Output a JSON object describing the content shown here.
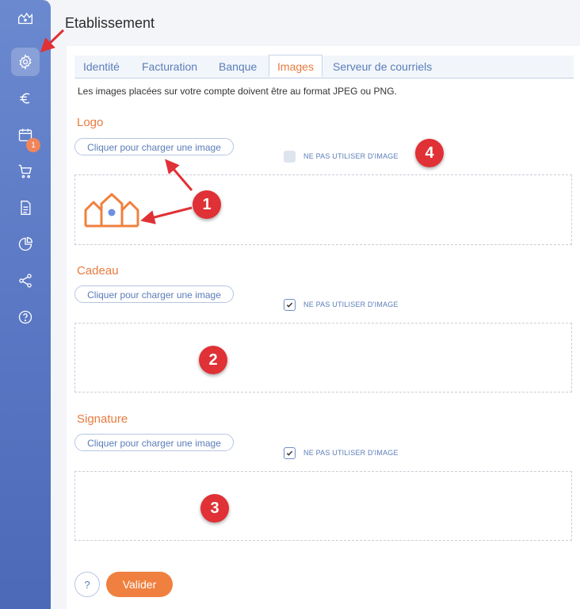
{
  "page": {
    "title": "Etablissement"
  },
  "sidebar": {
    "items": [
      {
        "icon": "home-icon"
      },
      {
        "icon": "gear-icon",
        "active": true
      },
      {
        "icon": "euro-icon"
      },
      {
        "icon": "calendar-icon",
        "badge": "1"
      },
      {
        "icon": "cart-icon"
      },
      {
        "icon": "document-icon"
      },
      {
        "icon": "pie-chart-icon"
      },
      {
        "icon": "share-icon"
      },
      {
        "icon": "help-icon"
      }
    ]
  },
  "tabs": [
    {
      "label": "Identité"
    },
    {
      "label": "Facturation"
    },
    {
      "label": "Banque"
    },
    {
      "label": "Images",
      "active": true
    },
    {
      "label": "Serveur de courriels"
    }
  ],
  "intro": "Les images placées sur votre compte doivent être au format JPEG ou PNG.",
  "sections": [
    {
      "title": "Logo",
      "upload_label": "Cliquer pour charger une image",
      "checkbox_label": "NE PAS UTILISER D'IMAGE",
      "checked": false
    },
    {
      "title": "Cadeau",
      "upload_label": "Cliquer pour charger une image",
      "checkbox_label": "NE PAS UTILISER D'IMAGE",
      "checked": true
    },
    {
      "title": "Signature",
      "upload_label": "Cliquer pour charger une image",
      "checkbox_label": "NE PAS UTILISER D'IMAGE",
      "checked": true
    }
  ],
  "footer": {
    "help_label": "?",
    "submit_label": "Valider"
  },
  "annotations": {
    "markers": [
      "1",
      "2",
      "3",
      "4"
    ]
  },
  "colors": {
    "accent": "#e87a3e",
    "primary": "#5b7db8",
    "sidebar": "#5a78c4",
    "marker": "#e03136"
  }
}
